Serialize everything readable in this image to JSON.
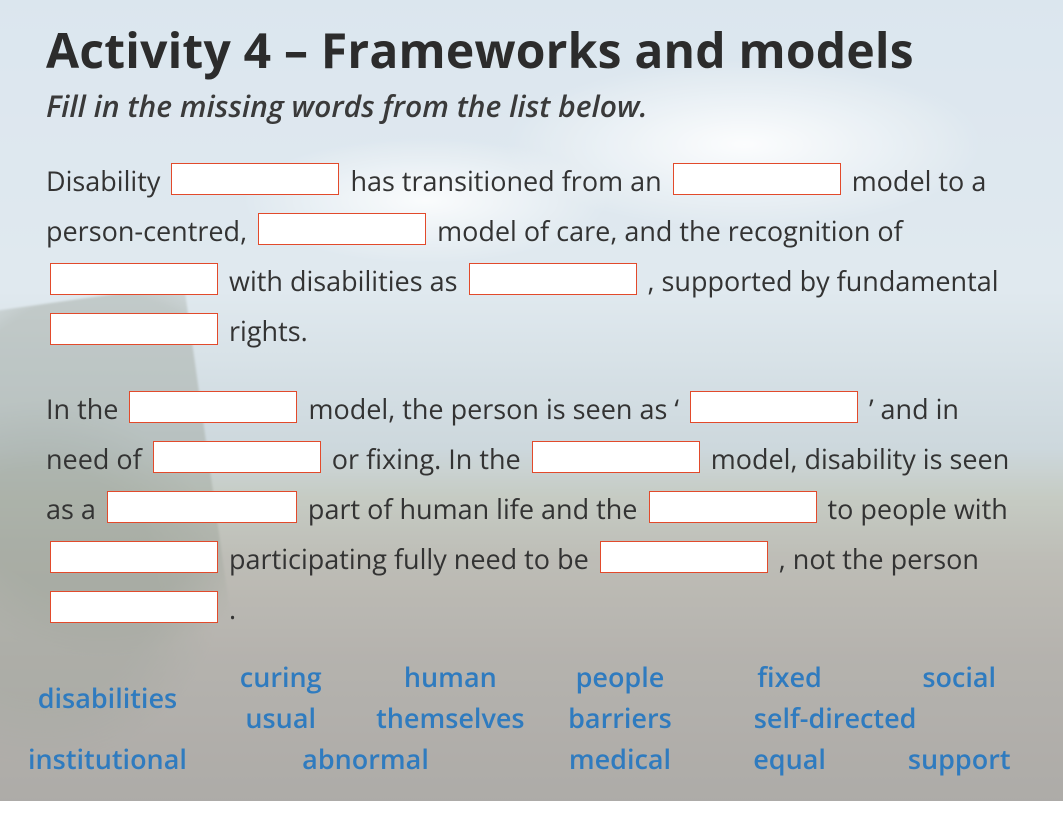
{
  "title": "Activity 4 – Frameworks and models",
  "subtitle": "Fill in the missing words from the list below.",
  "p1": {
    "t1": "Disability ",
    "t2": " has transitioned from an ",
    "t3": " model to a person-centred, ",
    "t4": " model of care, and the recognition of ",
    "t5": " with disabilities as ",
    "t6": ", supported by fundamental ",
    "t7": " rights."
  },
  "p2": {
    "t1": "In the ",
    "t2": " model, the person is seen as ‘",
    "t3": "’ and in need of ",
    "t4": " or fixing.  In the ",
    "t5": " model, disability is seen as a ",
    "t6": " part of human life and the ",
    "t7": " to people with ",
    "t8": " participating fully need to be ",
    "t9": ", not the person ",
    "t10": "."
  },
  "wordbank": {
    "disabilities": "disabilities",
    "institutional": "institutional",
    "curing": "curing",
    "usual": "usual",
    "abnormal": "abnormal",
    "human": "human",
    "themselves": "themselves",
    "medical": "medical",
    "people": "people",
    "barriers": "barriers",
    "equal": "equal",
    "fixed": "fixed",
    "self_directed": "self-directed",
    "social": "social",
    "support": "support"
  }
}
